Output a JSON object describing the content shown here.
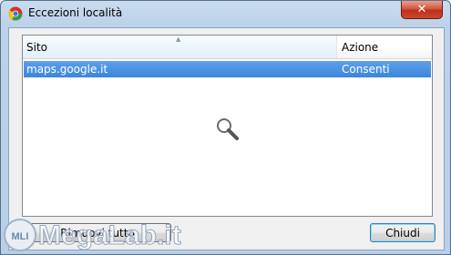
{
  "window": {
    "title": "Eccezioni località",
    "close_glyph": "✕"
  },
  "table": {
    "columns": [
      "Sito",
      "Azione"
    ],
    "rows": [
      {
        "site": "maps.google.it",
        "action": "Consenti"
      }
    ]
  },
  "buttons": {
    "remove_all": "Rimuovi tutto",
    "close": "Chiudi"
  },
  "watermark": {
    "text": "MegaLab.it",
    "badge": "MLI"
  },
  "colors": {
    "selection": "#3d86dc",
    "close_button": "#c84a2f"
  },
  "icons": [
    "chrome-icon",
    "close-icon",
    "magnifier-icon",
    "sort-arrow-icon"
  ]
}
